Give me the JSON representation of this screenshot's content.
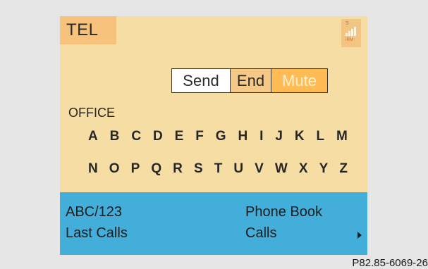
{
  "screen": {
    "title": "TEL",
    "signal": {
      "label": "S",
      "network": "IRM",
      "icon": "signal-strength-icon"
    },
    "buttons": {
      "send": "Send",
      "end": "End",
      "mute": "Mute"
    },
    "context": "OFFICE",
    "alphabet_row_1": [
      "A",
      "B",
      "C",
      "D",
      "E",
      "F",
      "G",
      "H",
      "I",
      "J",
      "K",
      "L",
      "M"
    ],
    "alphabet_row_2": [
      "N",
      "O",
      "P",
      "Q",
      "R",
      "S",
      "T",
      "U",
      "V",
      "W",
      "X",
      "Y",
      "Z"
    ],
    "menu": {
      "abc": "ABC/123",
      "last_calls": "Last Calls",
      "phone_book": "Phone Book",
      "calls": "Calls",
      "more_icon": "arrow-right-icon"
    }
  },
  "caption": "P82.85-6069-26",
  "colors": {
    "screen_bg": "#f6dda4",
    "title_box": "#f6c27c",
    "menu_bg": "#43aeda",
    "mute_bg": "#ffbc54"
  }
}
